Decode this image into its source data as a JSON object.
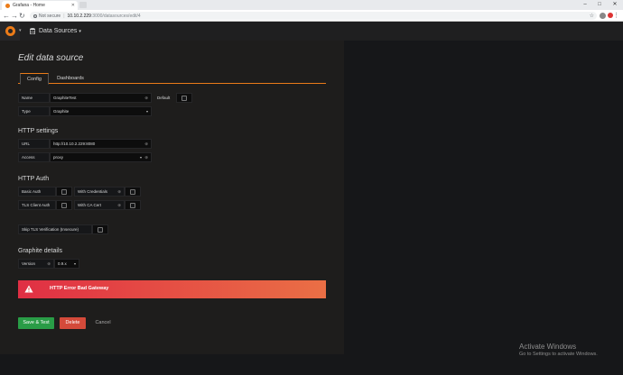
{
  "browser": {
    "tab_title": "Grafana - Home",
    "not_secure": "Not secure",
    "url_host": "10.10.2.229",
    "url_path": ":3000/datasources/edit/4"
  },
  "nav": {
    "breadcrumb": "Data Sources"
  },
  "page": {
    "title": "Edit data source",
    "tabs": [
      "Config",
      "Dashboards"
    ]
  },
  "config": {
    "name_label": "Name",
    "name_value": "GraphiteTest",
    "default_label": "Default",
    "type_label": "Type",
    "type_value": "Graphite"
  },
  "http_settings": {
    "heading": "HTTP settings",
    "url_label": "URL",
    "url_value": "http://10.10.2.229:8080",
    "access_label": "Access",
    "access_value": "proxy"
  },
  "http_auth": {
    "heading": "HTTP Auth",
    "basic_auth": "Basic Auth",
    "with_credentials": "With Credentials",
    "tls_client_auth": "TLS Client Auth",
    "with_ca_cert": "With CA Cert",
    "skip_tls": "Skip TLS Verification (Insecure)"
  },
  "graphite": {
    "heading": "Graphite details",
    "version_label": "Version",
    "version_value": "0.9.x"
  },
  "alert": {
    "text": "HTTP Error Bad Gateway",
    "color": "#e24d42"
  },
  "buttons": {
    "save": "Save & Test",
    "delete": "Delete",
    "cancel": "Cancel"
  },
  "watermark": {
    "line1": "Activate Windows",
    "line2": "Go to Settings to activate Windows."
  },
  "colors": {
    "accent": "#eb7b18",
    "save": "#299c46",
    "delete": "#d44a3a"
  }
}
